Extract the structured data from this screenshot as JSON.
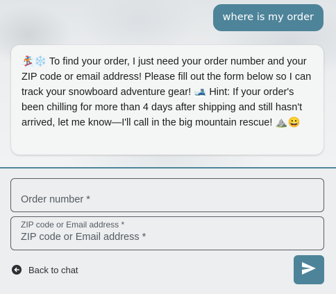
{
  "chat": {
    "user_message": "where is my order",
    "bot_message": "🏂❄️ To find your order, I just need your order number and your ZIP code or email address! Please fill out the form below so I can track your snowboard adventure gear! 🎿 Hint: If your order's been chilling for more than 4 days after shipping and still hasn't arrived, let me know—I'll call in the big mountain rescue! ⛰️😀"
  },
  "form": {
    "order_number_placeholder": "Order number *",
    "zip_label": "ZIP code or Email address *",
    "zip_placeholder": "ZIP code or Email address *",
    "back_label": "Back to chat"
  },
  "icons": {
    "back": "circle-arrow-left-icon",
    "send": "send-icon"
  },
  "colors": {
    "accent": "#4e8499",
    "bubble_text": "#ffffff",
    "bot_bubble_bg": "#f4f5f5"
  }
}
